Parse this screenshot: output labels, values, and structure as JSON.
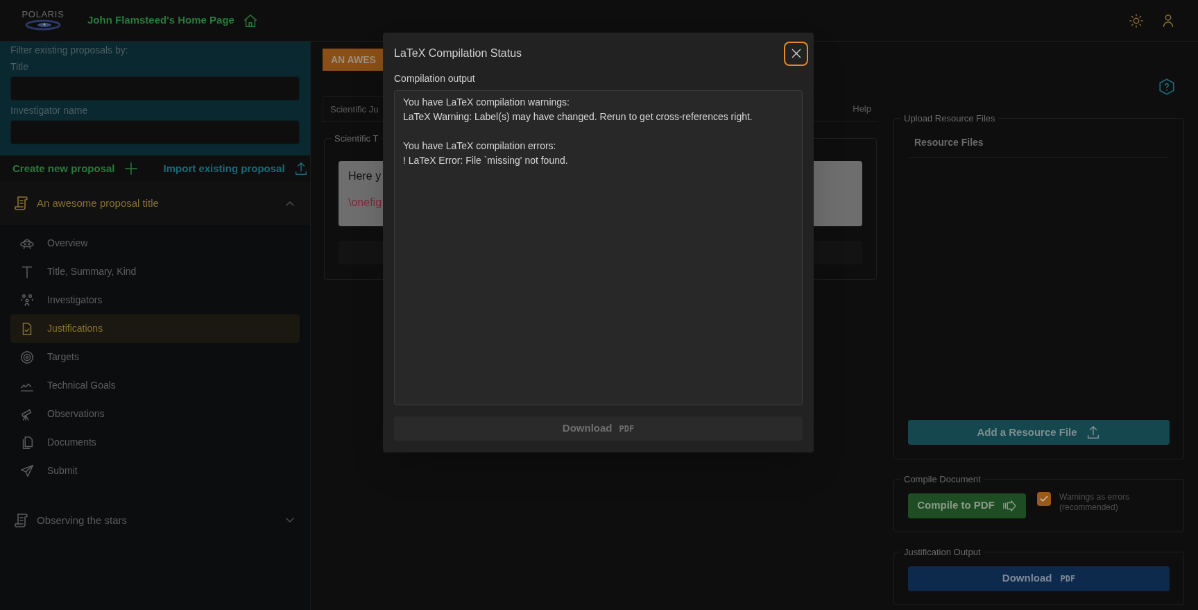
{
  "header": {
    "logo_text": "POLARIS",
    "home_link": "John Flamsteed's Home Page"
  },
  "filter": {
    "heading": "Filter existing proposals by:",
    "fields": [
      {
        "label": "Title"
      },
      {
        "label": "Investigator name"
      }
    ]
  },
  "actions": [
    {
      "kind": "create",
      "label": "Create new proposal"
    },
    {
      "kind": "import",
      "label": "Import existing proposal"
    }
  ],
  "proposals": [
    {
      "title": "An awesome proposal title",
      "expanded": true,
      "children": [
        {
          "kind": "overview",
          "label": "Overview",
          "selected": false
        },
        {
          "kind": "title",
          "label": "Title, Summary, Kind",
          "selected": false
        },
        {
          "kind": "investigators",
          "label": "Investigators",
          "selected": false
        },
        {
          "kind": "justifications",
          "label": "Justifications",
          "selected": true
        },
        {
          "kind": "targets",
          "label": "Targets",
          "selected": false
        },
        {
          "kind": "goals",
          "label": "Technical Goals",
          "selected": false
        },
        {
          "kind": "observations",
          "label": "Observations",
          "selected": false
        },
        {
          "kind": "documents",
          "label": "Documents",
          "selected": false
        },
        {
          "kind": "submit",
          "label": "Submit",
          "selected": false
        }
      ]
    },
    {
      "title": "Observing the stars",
      "expanded": false
    }
  ],
  "main": {
    "title_badge": "AN AWES",
    "tabs": [
      {
        "label": "Scientific Ju",
        "selected": true
      },
      {
        "label": "Help",
        "selected": false
      }
    ],
    "fieldset_legend": "Scientific T",
    "editor_lines": [
      {
        "kind": "text",
        "text": "Here y"
      },
      {
        "kind": "command",
        "text": "\\onefig"
      }
    ]
  },
  "right": {
    "upload": {
      "legend": "Upload Resource Files",
      "column": "Resource Files",
      "button": "Add a Resource File"
    },
    "compile": {
      "legend": "Compile Document",
      "button": "Compile to PDF",
      "checkbox": {
        "label": "Warnings as errors (recommended)",
        "checked": true
      }
    },
    "output": {
      "legend": "Justification Output",
      "button": {
        "label": "Download",
        "tag": "PDF"
      }
    }
  },
  "modal": {
    "title": "LaTeX Compilation Status",
    "output_label": "Compilation output",
    "output_blocks": [
      {
        "heading": "You have LaTeX compilation warnings:",
        "message": "LaTeX Warning: Label(s) may have changed. Rerun to get cross-references right."
      },
      {
        "heading": "You have LaTeX compilation errors:",
        "message": "! LaTeX Error: File `missing' not found."
      }
    ],
    "download": {
      "label": "Download",
      "tag": "PDF",
      "disabled": true
    }
  }
}
